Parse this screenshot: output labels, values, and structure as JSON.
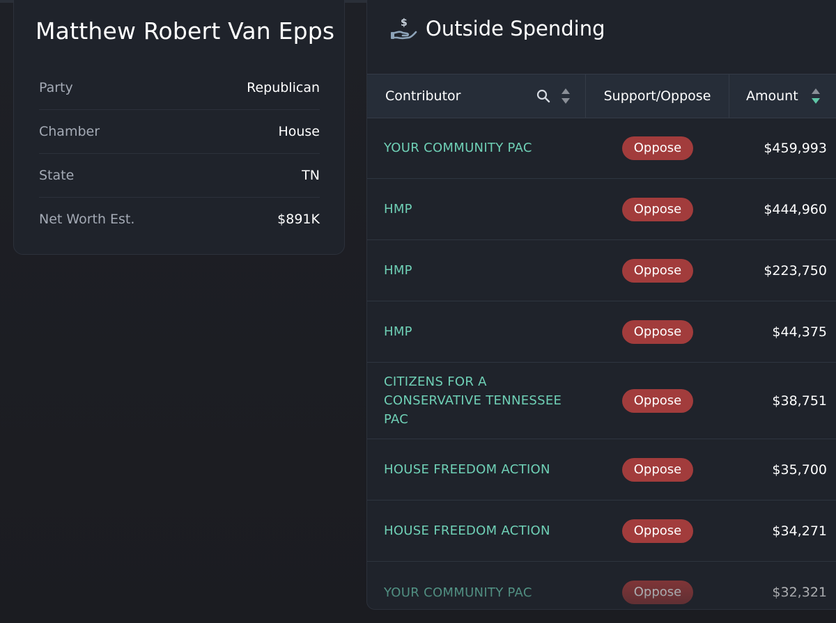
{
  "profile": {
    "name": "Matthew Robert Van Epps",
    "rows": [
      {
        "label": "Party",
        "value": "Republican"
      },
      {
        "label": "Chamber",
        "value": "House"
      },
      {
        "label": "State",
        "value": "TN"
      },
      {
        "label": "Net Worth Est.",
        "value": "$891K"
      }
    ]
  },
  "spending": {
    "title": "Outside Spending",
    "icon": "money-hand-icon",
    "columns": {
      "contributor": "Contributor",
      "support_oppose": "Support/Oppose",
      "amount": "Amount"
    },
    "colors": {
      "contributor_link": "#6fd0b6",
      "oppose_badge": "#a23c3c",
      "sort_active": "#5fc6a6"
    },
    "rows": [
      {
        "contributor": "YOUR COMMUNITY PAC",
        "stance": "Oppose",
        "amount": "$459,993"
      },
      {
        "contributor": "HMP",
        "stance": "Oppose",
        "amount": "$444,960"
      },
      {
        "contributor": "HMP",
        "stance": "Oppose",
        "amount": "$223,750"
      },
      {
        "contributor": "HMP",
        "stance": "Oppose",
        "amount": "$44,375"
      },
      {
        "contributor": "CITIZENS FOR A CONSERVATIVE TENNESSEE PAC",
        "stance": "Oppose",
        "amount": "$38,751"
      },
      {
        "contributor": "HOUSE FREEDOM ACTION",
        "stance": "Oppose",
        "amount": "$35,700"
      },
      {
        "contributor": "HOUSE FREEDOM ACTION",
        "stance": "Oppose",
        "amount": "$34,271"
      },
      {
        "contributor": "YOUR COMMUNITY PAC",
        "stance": "Oppose",
        "amount": "$32,321"
      }
    ]
  }
}
